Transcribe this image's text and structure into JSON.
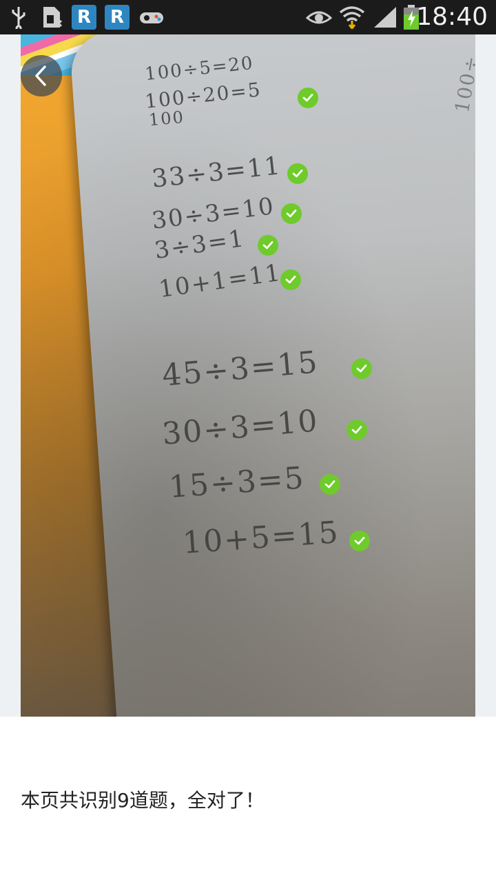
{
  "status_bar": {
    "time": "18:40",
    "icons": [
      "usb-icon",
      "sim-card-icon",
      "r-app-icon",
      "r-app-icon",
      "game-controller-icon",
      "eye-icon",
      "wifi-icon",
      "signal-icon",
      "battery-charging-icon"
    ],
    "r_label": "R"
  },
  "photo": {
    "handwriting": {
      "line1": "100÷5=20",
      "line2": "100÷20=5",
      "line3": "100",
      "line4": "33÷3=11",
      "line5": "30÷3=10",
      "line6": "3÷3=1",
      "line7": "10+1=11",
      "line8": "45÷3=15",
      "line9": "30÷3=10",
      "line10": "15÷3=5",
      "line11": "10+5=15"
    },
    "check_count": 9
  },
  "result_text": "本页共识别9道题，全对了！",
  "colors": {
    "check": "#6ecb2b",
    "status_bar_bg": "#1b1b1b",
    "back_button_bg": "#3c4650"
  }
}
